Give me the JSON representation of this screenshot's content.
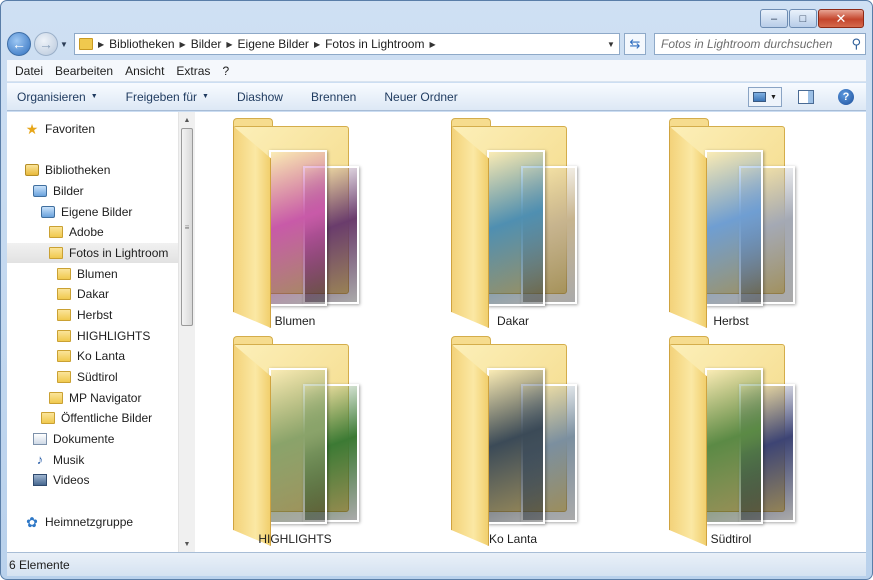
{
  "window": {
    "caption": {
      "minimize": "–",
      "maximize": "□",
      "close": "✕"
    }
  },
  "address": {
    "crumbs": [
      "Bibliotheken",
      "Bilder",
      "Eigene Bilder",
      "Fotos in Lightroom"
    ],
    "refresh_icon": "refresh-icon"
  },
  "search": {
    "placeholder": "Fotos in Lightroom durchsuchen"
  },
  "menu": [
    "Datei",
    "Bearbeiten",
    "Ansicht",
    "Extras",
    "?"
  ],
  "toolbar": {
    "organize": "Organisieren",
    "share": "Freigeben für",
    "slideshow": "Diashow",
    "burn": "Brennen",
    "new_folder": "Neuer Ordner"
  },
  "nav": {
    "favorites": "Favoriten",
    "libraries": "Bibliotheken",
    "pictures": "Bilder",
    "my_pictures": "Eigene Bilder",
    "adobe": "Adobe",
    "lightroom": "Fotos in Lightroom",
    "blumen": "Blumen",
    "dakar": "Dakar",
    "herbst": "Herbst",
    "highlights": "HIGHLIGHTS",
    "ko_lanta": "Ko Lanta",
    "suedtirol": "Südtirol",
    "mp_navigator": "MP Navigator",
    "public_pictures": "Öffentliche Bilder",
    "documents": "Dokumente",
    "music": "Musik",
    "videos": "Videos",
    "homegroup": "Heimnetzgruppe"
  },
  "folders": [
    {
      "name": "Blumen",
      "photo1": "#c85aa8",
      "photo2": "#6a3c6c"
    },
    {
      "name": "Dakar",
      "photo1": "#4f8fb1",
      "photo2": "#c7b48e"
    },
    {
      "name": "Herbst",
      "photo1": "#6f9ed2",
      "photo2": "#a4a9b4"
    },
    {
      "name": "HIGHLIGHTS",
      "photo1": "#8aa36a",
      "photo2": "#3c7a34"
    },
    {
      "name": "Ko Lanta",
      "photo1": "#3b4a57",
      "photo2": "#7b8f9f"
    },
    {
      "name": "Südtirol",
      "photo1": "#5b8a45",
      "photo2": "#3d4474"
    }
  ],
  "status": {
    "count": "6 Elemente"
  }
}
